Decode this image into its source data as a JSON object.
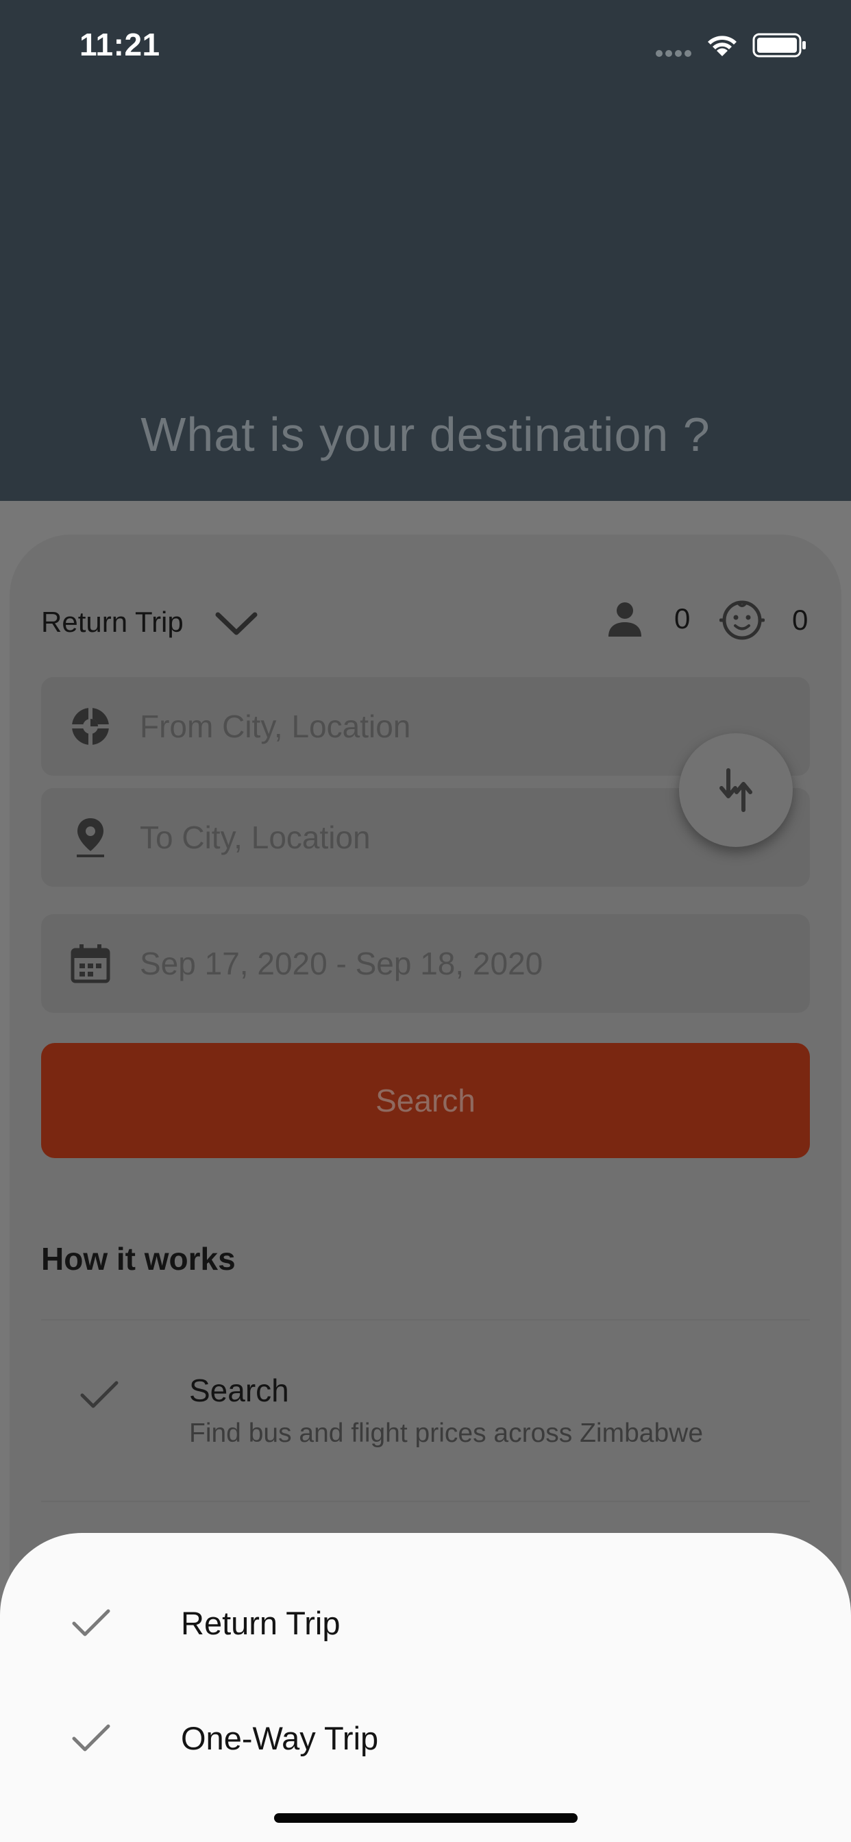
{
  "status_bar": {
    "time": "11:21"
  },
  "header": {
    "headline": "What is your destination ?"
  },
  "trip_type": {
    "selected": "Return Trip"
  },
  "passengers": {
    "adults": "0",
    "children": "0"
  },
  "from_field": {
    "placeholder": "From City, Location"
  },
  "to_field": {
    "placeholder": "To City, Location"
  },
  "date_field": {
    "value": "Sep 17, 2020 - Sep 18, 2020"
  },
  "search_button": {
    "label": "Search"
  },
  "how_it_works": {
    "title": "How it works",
    "steps": [
      {
        "title": "Search",
        "description": "Find bus and flight prices across Zimbabwe"
      }
    ]
  },
  "trip_sheet": {
    "options": [
      {
        "label": "Return Trip"
      },
      {
        "label": "One-Way Trip"
      }
    ]
  },
  "colors": {
    "header_bg": "#2e3840",
    "accent": "#7a2711",
    "sheet_bg": "#fafafa"
  },
  "icons": [
    "signal-icon",
    "wifi-icon",
    "battery-icon",
    "chevron-down-icon",
    "person-icon",
    "baby-face-icon",
    "location-target-icon",
    "location-pin-icon",
    "calendar-icon",
    "swap-icon",
    "check-icon"
  ]
}
